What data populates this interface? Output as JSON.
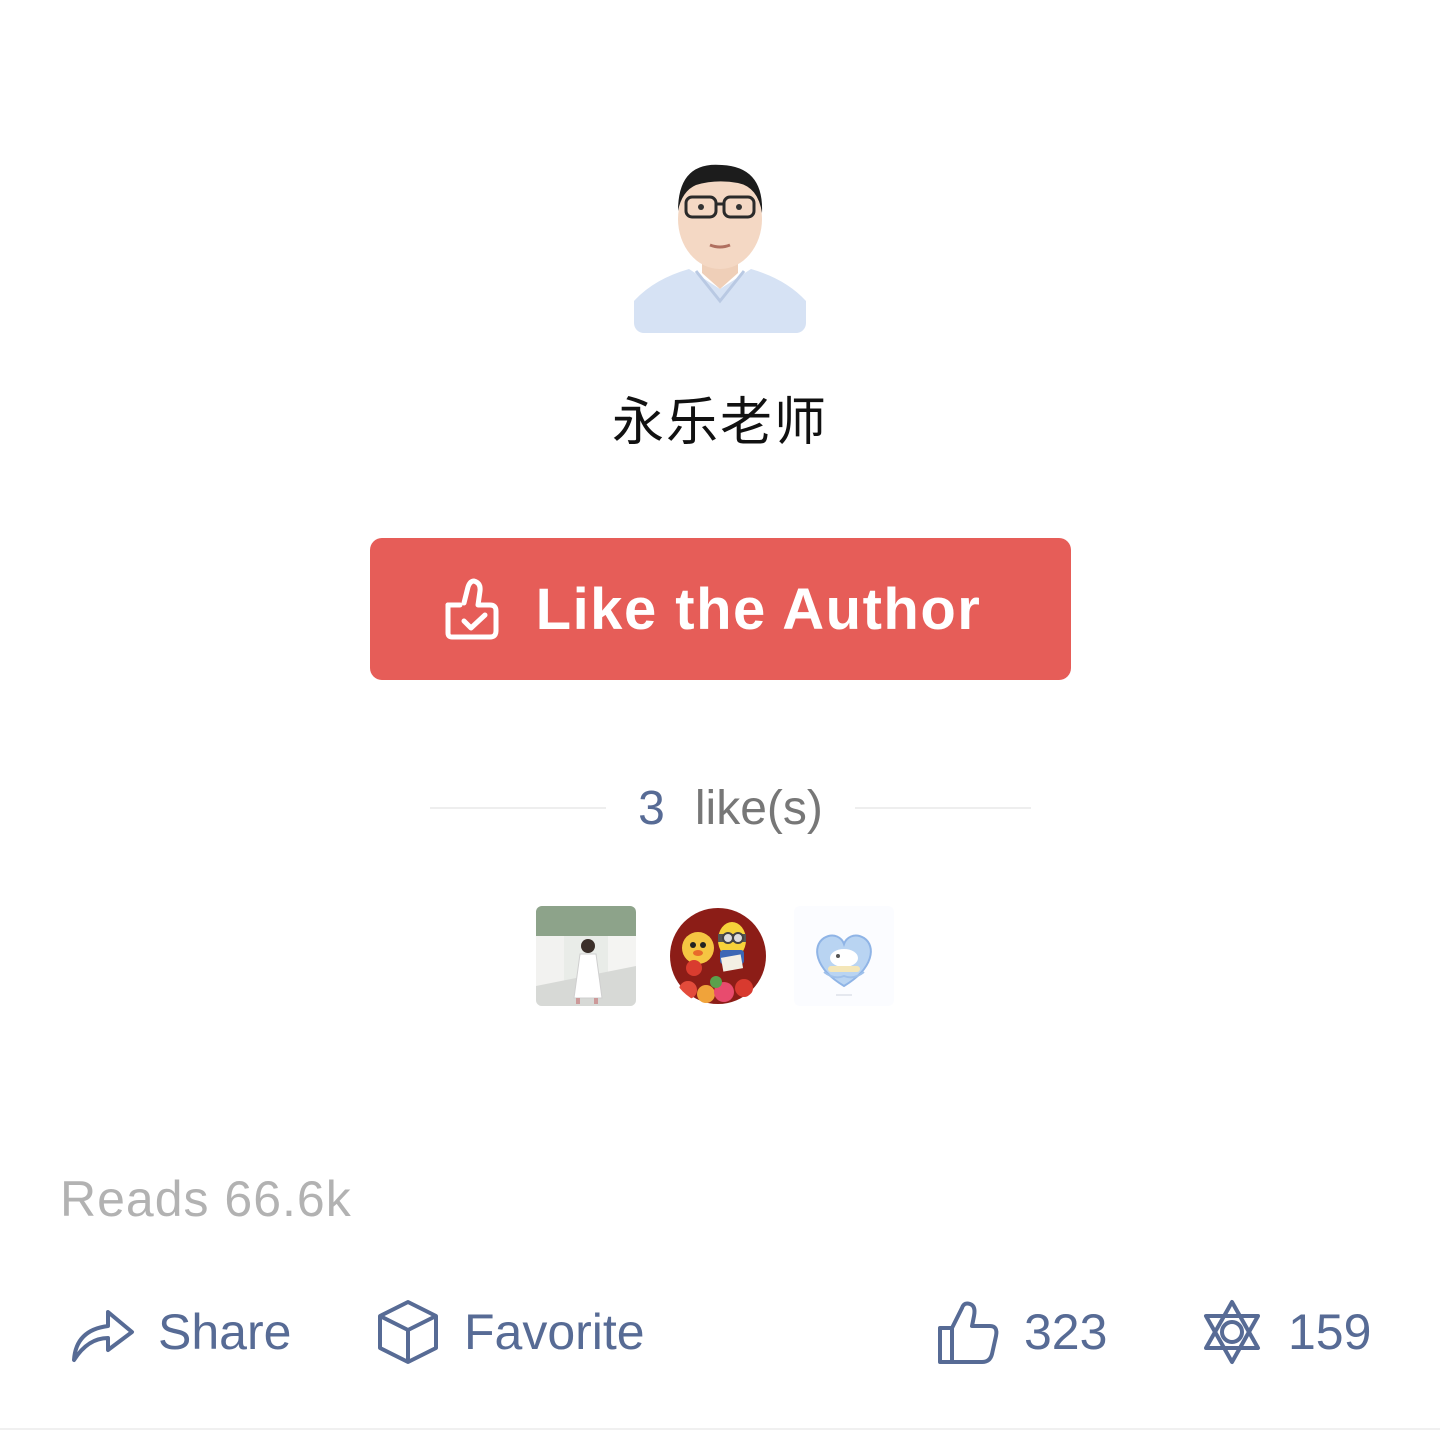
{
  "author": {
    "name": "永乐老师",
    "avatar_icon": "author-portrait"
  },
  "like_button": {
    "label": "Like the Author",
    "icon": "thumbs-up-check-icon",
    "color": "#e65d58"
  },
  "likes": {
    "count": "3",
    "suffix": "like(s)",
    "likers": [
      {
        "icon": "liker-avatar-photo"
      },
      {
        "icon": "liker-avatar-cartoon"
      },
      {
        "icon": "liker-avatar-heart"
      }
    ]
  },
  "stats": {
    "reads": "Reads 66.6k"
  },
  "toolbar": {
    "share_label": "Share",
    "favorite_label": "Favorite",
    "like_count": "323",
    "wow_count": "159",
    "accent": "#576b95"
  }
}
